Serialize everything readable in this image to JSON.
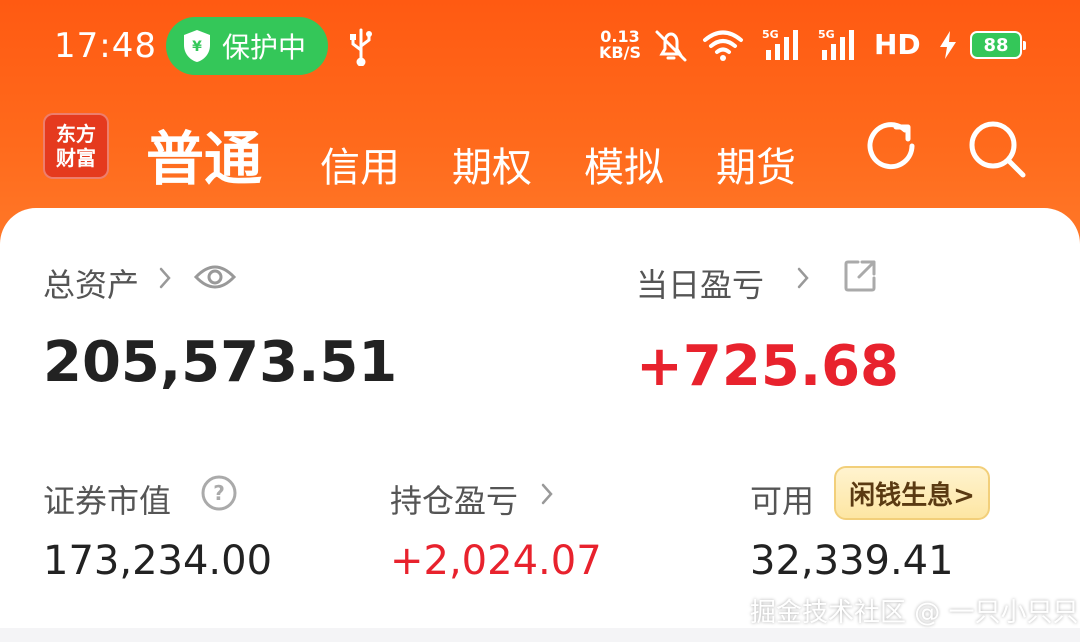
{
  "status_bar": {
    "time": "17:48",
    "protect_label": "保护中",
    "net_speed_value": "0.13",
    "net_speed_unit": "KB/S",
    "network_label": "HD",
    "battery": "88",
    "icons": [
      "shield-icon",
      "usb-icon",
      "mute-icon",
      "wifi-icon",
      "signal-icon",
      "signal-icon",
      "bolt-icon",
      "battery-icon"
    ]
  },
  "header": {
    "logo_line1": "东方",
    "logo_line2": "财富",
    "tabs": [
      {
        "label": "普通",
        "active": true
      },
      {
        "label": "信用",
        "active": false
      },
      {
        "label": "期权",
        "active": false
      },
      {
        "label": "模拟",
        "active": false
      },
      {
        "label": "期货",
        "active": false
      }
    ],
    "icons": [
      "refresh-icon",
      "search-icon"
    ],
    "accent_color": "#ff5a12"
  },
  "summary": {
    "total_assets_label": "总资产",
    "total_assets_value": "205,573.51",
    "day_pnl_label": "当日盈亏",
    "day_pnl_value": "+725.68",
    "securities_label": "证券市值",
    "securities_value": "173,234.00",
    "holding_pnl_label": "持仓盈亏",
    "holding_pnl_value": "+2,024.07",
    "available_label": "可用",
    "available_value": "32,339.41",
    "idle_money_badge": "闲钱生息>",
    "positive_color": "#e8222d"
  },
  "watermark": "掘金技术社区 @ 一只小只只"
}
